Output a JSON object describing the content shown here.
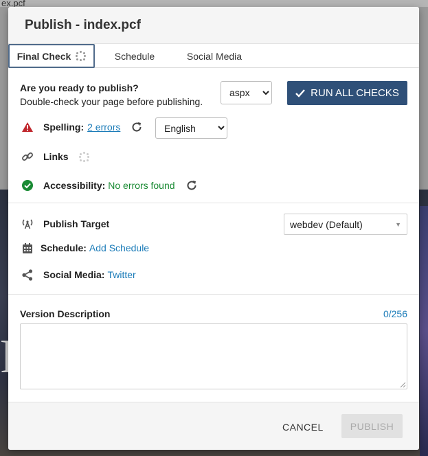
{
  "background": {
    "partial_filename": "ex.pcf"
  },
  "dialog": {
    "title": "Publish - index.pcf"
  },
  "tabs": [
    {
      "label": "Final Check"
    },
    {
      "label": "Schedule"
    },
    {
      "label": "Social Media"
    }
  ],
  "ready": {
    "heading": "Are you ready to publish?",
    "subtext": "Double-check your page before publishing.",
    "format_selected": "aspx",
    "run_checks_label": "RUN ALL CHECKS"
  },
  "checks": {
    "spelling": {
      "label": "Spelling:",
      "result": "2 errors",
      "language": "English",
      "status_icon": "warning-triangle-icon"
    },
    "links": {
      "label": "Links",
      "status_icon": "link-icon"
    },
    "accessibility": {
      "label": "Accessibility:",
      "result": "No errors found",
      "status_icon": "check-circle-icon"
    }
  },
  "publish": {
    "target_label": "Publish Target",
    "target_selected": "webdev (Default)",
    "schedule_label": "Schedule:",
    "schedule_link": "Add Schedule",
    "social_label": "Social Media:",
    "social_link": "Twitter"
  },
  "version": {
    "label": "Version Description",
    "counter": "0/256",
    "value": ""
  },
  "footer": {
    "cancel_label": "CANCEL",
    "publish_label": "PUBLISH"
  },
  "colors": {
    "primary": "#2f5078",
    "link": "#1a7bb8",
    "success": "#198a33",
    "warning": "#c0272d"
  }
}
